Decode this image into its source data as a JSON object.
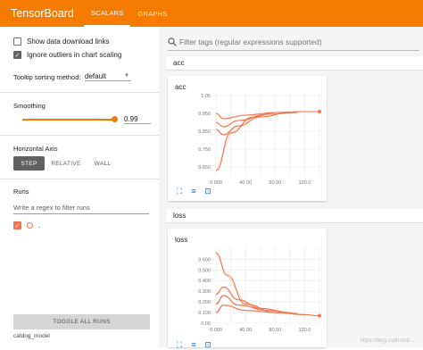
{
  "header": {
    "brand": "TensorBoard",
    "tabs": [
      {
        "label": "SCALARS",
        "active": true
      },
      {
        "label": "GRAPHS",
        "active": false
      }
    ]
  },
  "sidebar": {
    "show_download_label": "Show data download links",
    "show_download_checked": false,
    "ignore_outliers_label": "Ignore outliers in chart scaling",
    "ignore_outliers_checked": true,
    "tooltip_label": "Tooltip sorting method:",
    "tooltip_value": "default",
    "smoothing_label": "Smoothing",
    "smoothing_value": "0.99",
    "smoothing_fraction": 0.99,
    "horizontal_axis_label": "Horizontal Axis",
    "axis_options": [
      {
        "label": "STEP",
        "active": true
      },
      {
        "label": "RELATIVE",
        "active": false
      },
      {
        "label": "WALL",
        "active": false
      }
    ],
    "runs_label": "Runs",
    "runs_filter_placeholder": "Write a regex to filter runs",
    "run_item_label": ".",
    "run_checked": true,
    "toggle_all_label": "TOGGLE ALL RUNS",
    "run_dir": "catdog_model"
  },
  "main": {
    "search_placeholder": "Filter tags (regular expressions supported)",
    "groups": [
      {
        "header": "acc",
        "card_title": "acc"
      },
      {
        "header": "loss",
        "card_title": "loss"
      }
    ],
    "watermark": "https://blog.csdn.net/..."
  },
  "chart_data": [
    {
      "type": "line",
      "title": "acc",
      "x_ticks": [
        "0.000",
        "40.00",
        "80.00",
        "120.0"
      ],
      "y_ticks": [
        "0.650",
        "0.750",
        "0.850",
        "0.950",
        "1.05"
      ],
      "xlim": [
        0,
        140
      ],
      "ylim": [
        0.6,
        1.06
      ],
      "series": [
        {
          "values": [
            [
              0,
              0.63
            ],
            [
              20,
              0.84
            ],
            [
              50,
              0.93
            ],
            [
              80,
              0.955
            ],
            [
              120,
              0.96
            ],
            [
              140,
              0.96
            ]
          ]
        },
        {
          "values": [
            [
              0,
              0.86
            ],
            [
              10,
              0.83
            ],
            [
              30,
              0.88
            ],
            [
              60,
              0.93
            ],
            [
              100,
              0.955
            ]
          ]
        },
        {
          "values": [
            [
              0,
              0.9
            ],
            [
              10,
              0.875
            ],
            [
              30,
              0.91
            ],
            [
              70,
              0.945
            ],
            [
              110,
              0.955
            ]
          ]
        },
        {
          "values": [
            [
              0,
              0.95
            ],
            [
              10,
              0.92
            ],
            [
              40,
              0.94
            ],
            [
              80,
              0.955
            ],
            [
              120,
              0.96
            ]
          ]
        }
      ],
      "accent": "#f1744c"
    },
    {
      "type": "line",
      "title": "loss",
      "x_ticks": [
        "0.000",
        "40.00",
        "80.00",
        "120.0"
      ],
      "y_ticks": [
        "0.00",
        "0.100",
        "0.200",
        "0.300",
        "0.400",
        "0.500",
        "0.600"
      ],
      "xlim": [
        0,
        140
      ],
      "ylim": [
        0,
        0.72
      ],
      "series": [
        {
          "values": [
            [
              0,
              0.66
            ],
            [
              15,
              0.45
            ],
            [
              40,
              0.18
            ],
            [
              80,
              0.1
            ],
            [
              120,
              0.08
            ],
            [
              140,
              0.07
            ]
          ]
        },
        {
          "values": [
            [
              0,
              0.27
            ],
            [
              10,
              0.34
            ],
            [
              30,
              0.22
            ],
            [
              60,
              0.14
            ],
            [
              100,
              0.1
            ]
          ]
        },
        {
          "values": [
            [
              0,
              0.18
            ],
            [
              10,
              0.26
            ],
            [
              30,
              0.17
            ],
            [
              70,
              0.12
            ],
            [
              110,
              0.09
            ]
          ]
        },
        {
          "values": [
            [
              0,
              0.1
            ],
            [
              10,
              0.17
            ],
            [
              40,
              0.12
            ],
            [
              80,
              0.1
            ],
            [
              120,
              0.08
            ]
          ]
        }
      ],
      "accent": "#f1744c"
    }
  ]
}
